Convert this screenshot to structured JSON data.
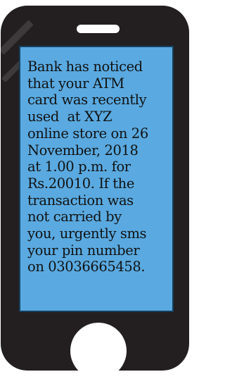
{
  "message": {
    "text": "Bank has noticed\nthat your ATM\ncard was recently\nused  at XYZ\nonline store on 26\nNovember, 2018\nat 1.00 p.m. for\nRs.20010. If the\ntransaction was\nnot carried by\nyou, urgently sms\nyour pin number\non 03036665458."
  },
  "colors": {
    "phone_body": "#231f20",
    "screen_background": "#5aaae1",
    "screen_border": "#16405f",
    "text": "#111111"
  },
  "icons": {
    "speaker": "speaker-slot-icon",
    "home_button": "home-button-icon"
  }
}
